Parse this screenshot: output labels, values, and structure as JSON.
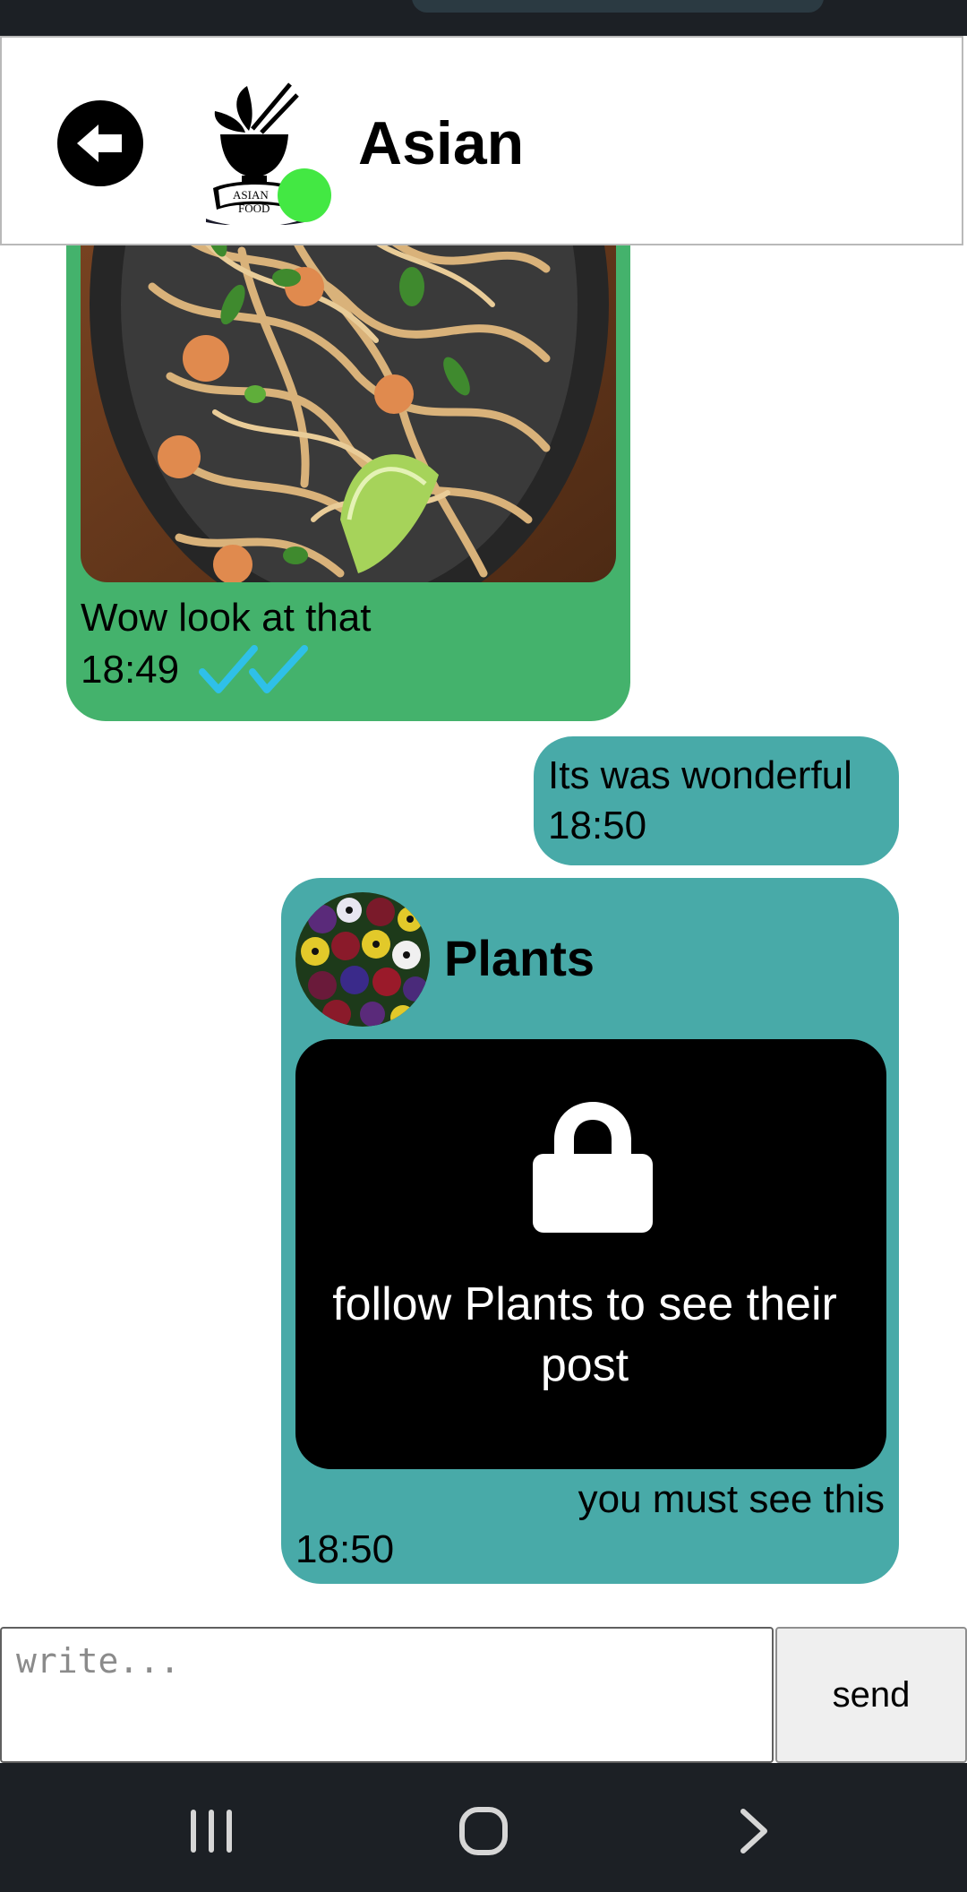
{
  "header": {
    "title": "Asian",
    "logo_text_top": "ASIAN",
    "logo_text_bottom": "FOOD",
    "online_color": "#43e843",
    "back_icon": "arrow-left-circle-icon"
  },
  "messages": [
    {
      "direction": "received",
      "image": "pad-thai-noodles-photo",
      "text": "Wow look at that",
      "time": "18:49",
      "status_icon": "double-check-icon",
      "bubble_color": "#44b26c"
    },
    {
      "direction": "sent",
      "text": "Its was wonderful",
      "time": "18:50",
      "bubble_color": "#48aaa8"
    },
    {
      "direction": "sent",
      "shared_profile": "Plants",
      "locked_text": "follow Plants to see their post",
      "text": "you must see this",
      "time": "18:50",
      "bubble_color": "#48aaa8"
    }
  ],
  "composer": {
    "placeholder": "write...",
    "value": "",
    "send_label": "send"
  },
  "navigation": {
    "icons": [
      "recent-apps-icon",
      "home-icon",
      "back-chevron-icon"
    ]
  }
}
